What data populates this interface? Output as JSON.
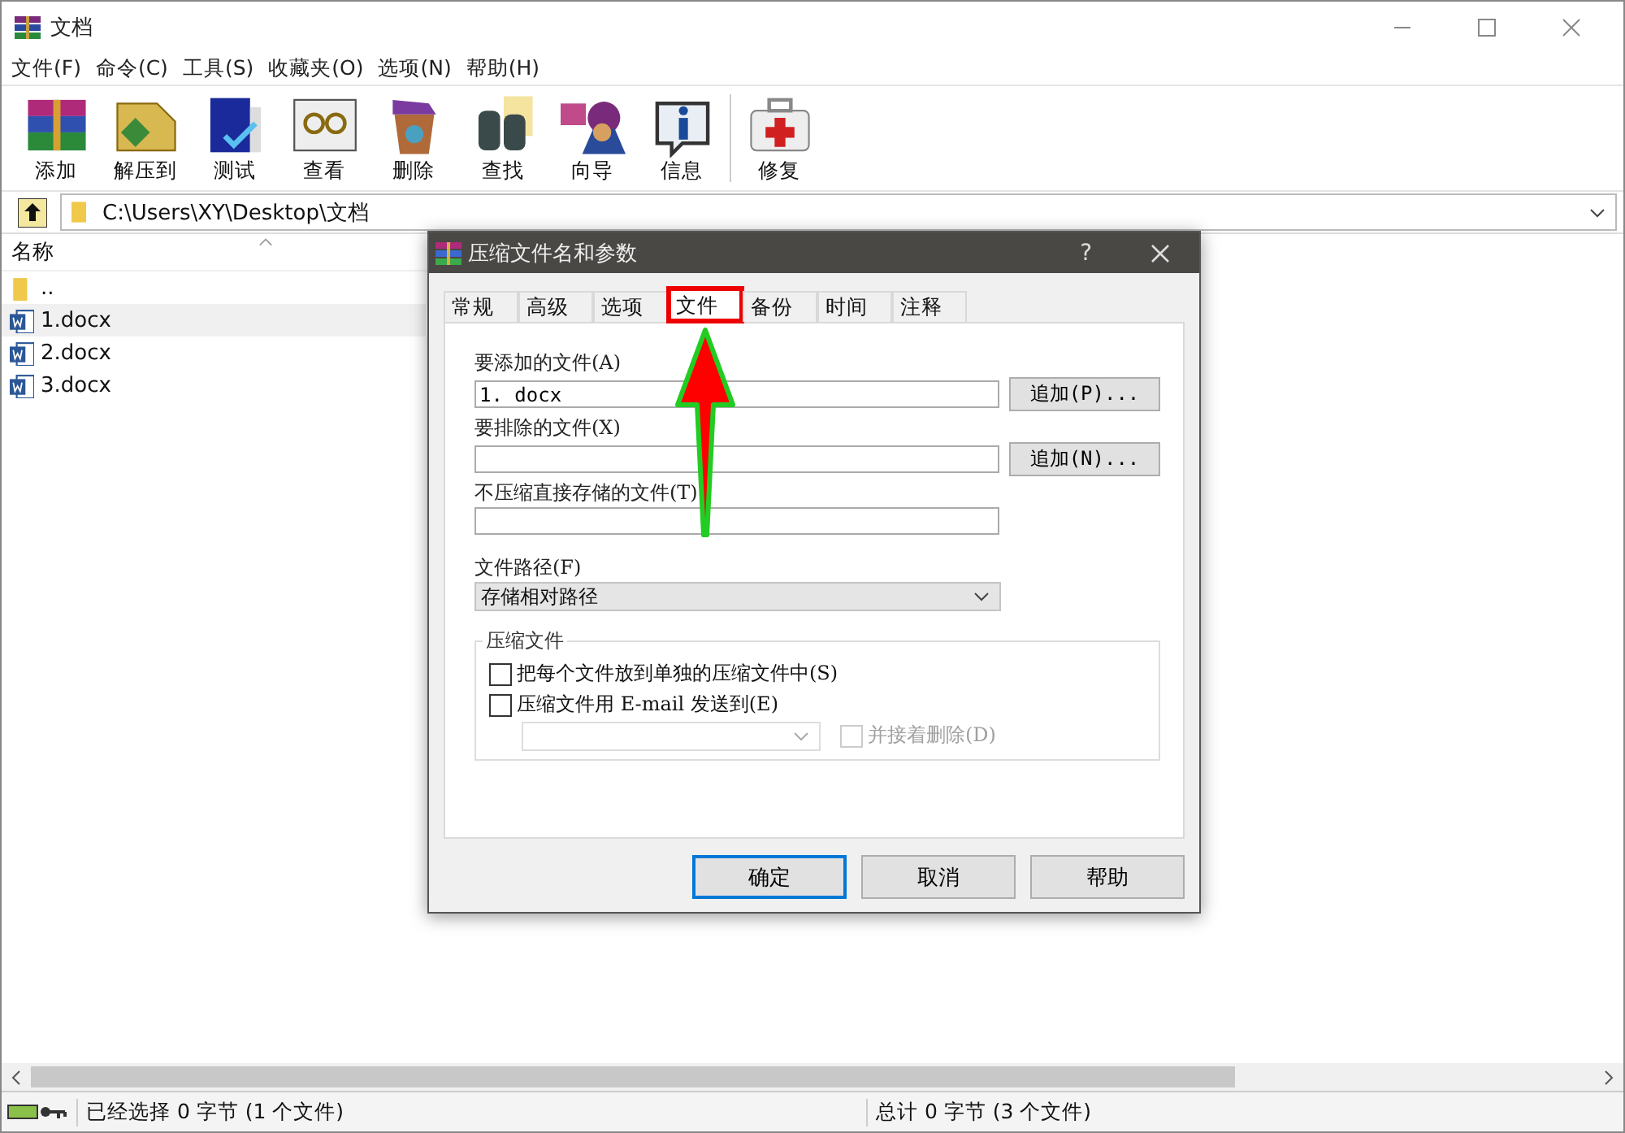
{
  "window": {
    "title": "文档"
  },
  "menu": [
    "文件(F)",
    "命令(C)",
    "工具(S)",
    "收藏夹(O)",
    "选项(N)",
    "帮助(H)"
  ],
  "toolbar": [
    {
      "label": "添加",
      "separator_before": false
    },
    {
      "label": "解压到",
      "separator_before": false
    },
    {
      "label": "测试",
      "separator_before": false
    },
    {
      "label": "查看",
      "separator_before": false
    },
    {
      "label": "删除",
      "separator_before": false
    },
    {
      "label": "查找",
      "separator_before": false
    },
    {
      "label": "向导",
      "separator_before": false
    },
    {
      "label": "信息",
      "separator_before": false
    },
    {
      "label": "修复",
      "separator_before": true
    }
  ],
  "address": {
    "path": "C:\\Users\\XY\\Desktop\\文档"
  },
  "file_list": {
    "columns": [
      "名称"
    ],
    "rows": [
      {
        "name": "..",
        "kind": "folder",
        "selected": false
      },
      {
        "name": "1.docx",
        "kind": "document",
        "selected": true
      },
      {
        "name": "2.docx",
        "kind": "document",
        "selected": false
      },
      {
        "name": "3.docx",
        "kind": "document",
        "selected": false
      }
    ]
  },
  "dialog": {
    "title": "压缩文件名和参数",
    "help": "?",
    "tabs": [
      {
        "label": "常规",
        "selected": false,
        "highlighted": false
      },
      {
        "label": "高级",
        "selected": false,
        "highlighted": false
      },
      {
        "label": "选项",
        "selected": false,
        "highlighted": false
      },
      {
        "label": "文件",
        "selected": true,
        "highlighted": true
      },
      {
        "label": "备份",
        "selected": false,
        "highlighted": false
      },
      {
        "label": "时间",
        "selected": false,
        "highlighted": false
      },
      {
        "label": "注释",
        "selected": false,
        "highlighted": false
      }
    ],
    "fields": [
      {
        "label": "要添加的文件(A)",
        "value": "1. docx",
        "button": "追加(P)..."
      },
      {
        "label": "要排除的文件(X)",
        "button": "追加(N)..."
      },
      {
        "label": "不压缩直接存储的文件(T)"
      }
    ],
    "path": {
      "label": "文件路径(F)",
      "value": "存储相对路径"
    },
    "group": {
      "title": "压缩文件",
      "options": [
        {
          "label": "把每个文件放到单独的压缩文件中(S)",
          "checked": false
        },
        {
          "label": "压缩文件用 E-mail 发送到(E)",
          "checked": false
        }
      ],
      "delete_option": {
        "label": "并接着删除(D)",
        "checked": false,
        "disabled": true
      }
    },
    "buttons": [
      {
        "label": "确定",
        "default": true
      },
      {
        "label": "取消",
        "default": false
      },
      {
        "label": "帮助",
        "default": false
      }
    ]
  },
  "status_bar": {
    "left": "已经选择 0 字节 (1 个文件)",
    "right": "总计 0 字节 (3 个文件)"
  }
}
